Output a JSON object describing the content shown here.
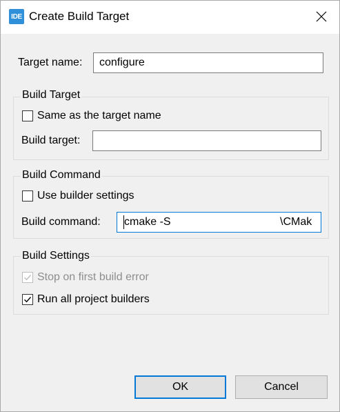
{
  "window": {
    "title": "Create Build Target",
    "app_icon_text": "IDE"
  },
  "target_name": {
    "label": "Target name:",
    "value": "configure"
  },
  "build_target_group": {
    "title": "Build Target",
    "same_as_name": {
      "label": "Same as the target name",
      "checked": false
    },
    "build_target_label": "Build target:",
    "build_target_value": ""
  },
  "build_command_group": {
    "title": "Build Command",
    "use_builder": {
      "label": "Use builder settings",
      "checked": false
    },
    "command_label": "Build command:",
    "command_value_start": "cmake -S",
    "command_value_end": "\\CMak"
  },
  "build_settings_group": {
    "title": "Build Settings",
    "stop_on_error": {
      "label": "Stop on first build error",
      "checked": true,
      "disabled": true
    },
    "run_all": {
      "label": "Run all project builders",
      "checked": true,
      "disabled": false
    }
  },
  "buttons": {
    "ok": "OK",
    "cancel": "Cancel"
  },
  "colors": {
    "accent": "#0078d7",
    "icon_bg": "#2f8fd8",
    "dialog_bg": "#f0f0f0"
  }
}
